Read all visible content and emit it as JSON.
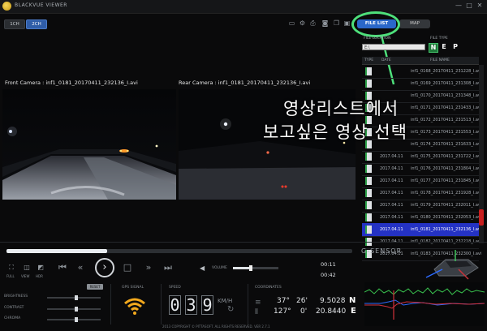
{
  "app": {
    "title": "BLACKVUE VIEWER",
    "window_controls": [
      "—",
      "□",
      "✕"
    ]
  },
  "toolbar": {
    "modes": [
      {
        "label": "1CH",
        "active": false
      },
      {
        "label": "2CH",
        "active": true
      }
    ],
    "tools": [
      "folder-icon",
      "gear-icon",
      "print-icon",
      "camera-icon",
      "copy-icon",
      "save-icon"
    ],
    "file_list_label": "FILE LIST",
    "map_label": "MAP"
  },
  "video": {
    "front_label": "Front Camera : inf1_0181_20170411_232136_I.avi",
    "rear_label": "Rear Camera : inf1_0181_20170411_232136_I.avi"
  },
  "annotation": {
    "line1": "영상리스트에서",
    "line2": "보고싶은 영상 선택",
    "ring_color": "#4ee07b"
  },
  "file_panel": {
    "location_label": "FILE LOCATION",
    "location_value": "E:\\",
    "type_label": "FILE TYPE",
    "types": [
      "N",
      "E",
      "P"
    ],
    "active_type": "N",
    "columns": [
      "TYPE",
      "DATE",
      "FILE NAME"
    ],
    "files": [
      {
        "date": "",
        "name": "inf1_0168_20170411_231228_I.avi",
        "selected": false
      },
      {
        "date": "",
        "name": "inf1_0169_20170411_231308_I.avi",
        "selected": false
      },
      {
        "date": "",
        "name": "inf1_0170_20170411_231348_I.avi",
        "selected": false
      },
      {
        "date": "",
        "name": "inf1_0171_20170411_231433_I.avi",
        "selected": false
      },
      {
        "date": "",
        "name": "inf1_0172_20170411_231513_I.avi",
        "selected": false
      },
      {
        "date": "",
        "name": "inf1_0173_20170411_231553_I.avi",
        "selected": false
      },
      {
        "date": "",
        "name": "inf1_0174_20170411_231633_I.avi",
        "selected": false
      },
      {
        "date": "2017.04.11",
        "name": "inf1_0175_20170411_231722_I.avi",
        "selected": false
      },
      {
        "date": "2017.04.11",
        "name": "inf1_0176_20170411_231804_I.avi",
        "selected": false
      },
      {
        "date": "2017.04.11",
        "name": "inf1_0177_20170411_231845_I.avi",
        "selected": false
      },
      {
        "date": "2017.04.11",
        "name": "inf1_0178_20170411_231928_I.avi",
        "selected": false
      },
      {
        "date": "2017.04.11",
        "name": "inf1_0179_20170411_232011_I.avi",
        "selected": false
      },
      {
        "date": "2017.04.11",
        "name": "inf1_0180_20170411_232053_I.avi",
        "selected": false
      },
      {
        "date": "2017.04.11",
        "name": "inf1_0181_20170411_232136_I.avi",
        "selected": true
      },
      {
        "date": "2017.04.11",
        "name": "inf1_0182_20170411_232218_I.avi",
        "selected": false
      },
      {
        "date": "2017.04.11",
        "name": "inf1_0183_20170411_232300_I.avi",
        "selected": false
      }
    ]
  },
  "playback": {
    "progress_fraction": 0.29,
    "view_buttons": [
      "FULL",
      "VIEW",
      "HDR"
    ],
    "volume_label": "VOLUME",
    "volume_fraction": 0.4,
    "time_current": "00:11",
    "time_total": "00:42",
    "gsensor_label": "G-SENSOR"
  },
  "adjust": {
    "reset_label": "RESET",
    "items": [
      {
        "label": "BRIGHTNESS",
        "value": 0.55
      },
      {
        "label": "CONTRAST",
        "value": 0.55
      },
      {
        "label": "CHROMA",
        "value": 0.55
      }
    ]
  },
  "gps": {
    "label": "GPS SIGNAL",
    "icon": "wifi-signal-icon",
    "color": "#f2a81d"
  },
  "speed": {
    "label": "SPEED",
    "digits": [
      "0",
      "3",
      "9"
    ],
    "unit": "KM/H"
  },
  "coordinates": {
    "label": "COORDINATES",
    "lat": {
      "deg": "37°",
      "min": "26'",
      "sec": "9.5028",
      "dir": "N"
    },
    "lon": {
      "deg": "127°",
      "min": "0'",
      "sec": "20.8440",
      "dir": "E"
    }
  },
  "footer": {
    "copyright": "2013 COPYRIGHT © PITTASOFT. ALL RIGHTS RESERVED. VER 2.7.1"
  }
}
